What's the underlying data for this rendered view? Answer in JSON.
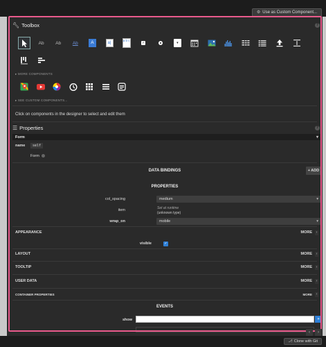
{
  "topbar": {
    "custom_component_label": "Use as Custom Component..."
  },
  "toolbox": {
    "title": "Toolbox",
    "help": "?",
    "tools_row1": [
      {
        "name": "pointer-tool",
        "icon": "cursor-icon",
        "text": ""
      },
      {
        "name": "text-tool",
        "icon": "ab-text-icon",
        "text": "Ab"
      },
      {
        "name": "rich-text-tool",
        "icon": "ab-rich-text-icon",
        "text": "Ab"
      },
      {
        "name": "link-tool",
        "icon": "ab-link-icon",
        "text": "Ab"
      },
      {
        "name": "label-tool",
        "icon": "label-icon",
        "text": "A"
      },
      {
        "name": "textbox-tool",
        "icon": "textbox-icon",
        "text": "a|"
      },
      {
        "name": "textarea-tool",
        "icon": "textarea-icon",
        "text": "a b c"
      },
      {
        "name": "checkbox-tool",
        "icon": "checkbox-icon",
        "text": "✓"
      },
      {
        "name": "radio-tool",
        "icon": "radio-icon",
        "text": ""
      },
      {
        "name": "dropdown-tool",
        "icon": "dropdown-icon",
        "text": "▾"
      },
      {
        "name": "datepicker-tool",
        "icon": "calendar-icon",
        "text": ""
      },
      {
        "name": "image-tool",
        "icon": "image-icon",
        "text": ""
      },
      {
        "name": "plot-tool",
        "icon": "bar-chart-icon",
        "text": ""
      },
      {
        "name": "grid-tool",
        "icon": "grid-icon",
        "text": ""
      },
      {
        "name": "repeating-panel-tool",
        "icon": "list-icon",
        "text": ""
      },
      {
        "name": "file-loader-tool",
        "icon": "upload-icon",
        "text": ""
      },
      {
        "name": "spacer-tool",
        "icon": "spacer-icon",
        "text": ""
      }
    ],
    "tools_row2": [
      {
        "name": "column-panel-tool",
        "icon": "column-panel-icon"
      },
      {
        "name": "flow-panel-tool",
        "icon": "flow-panel-icon"
      }
    ],
    "more_components_label": "▸ MORE COMPONENTS",
    "more_components": [
      {
        "name": "google-map-tool",
        "icon": "map-icon"
      },
      {
        "name": "youtube-tool",
        "icon": "youtube-icon"
      },
      {
        "name": "color-tool",
        "icon": "color-wheel-icon"
      },
      {
        "name": "timer-tool",
        "icon": "timer-icon"
      },
      {
        "name": "data-grid-tool",
        "icon": "grid-dots-icon"
      },
      {
        "name": "list-tool",
        "icon": "list-lines-icon"
      },
      {
        "name": "text-block-tool",
        "icon": "text-block-icon"
      }
    ],
    "see_custom_label": "▸ SEE CUSTOM COMPONENTS..."
  },
  "hint": "Click on components in the designer to select and edit them",
  "properties": {
    "title": "Properties",
    "help": "?",
    "form_bar": "Form",
    "name_label": "name",
    "name_value": "self",
    "form_link": "Form",
    "data_bindings": "DATA BINDINGS",
    "add_label": "+ ADD",
    "properties_head": "PROPERTIES",
    "col_spacing_label": "col_spacing",
    "col_spacing_value": "medium",
    "item_label": "item",
    "item_value_1": "Set at runtime",
    "item_value_2": "(unknown type)",
    "wrap_on_label": "wrap_on",
    "wrap_on_value": "mobile",
    "appearance_label": "APPEARANCE",
    "more": "MORE",
    "visible_label": "visible",
    "layout_label": "LAYOUT",
    "tooltip_label": "TOOLTIP",
    "user_data_label": "USER DATA",
    "container_props_label": "CONTAINER PROPERTIES",
    "events_head": "EVENTS",
    "show_label": "show",
    "event_btn": "»"
  },
  "bottombar": {
    "clone_label": "Clone with Git"
  },
  "colors": {
    "accent": "#e95a8c",
    "checkbox": "#2f7fd6"
  }
}
